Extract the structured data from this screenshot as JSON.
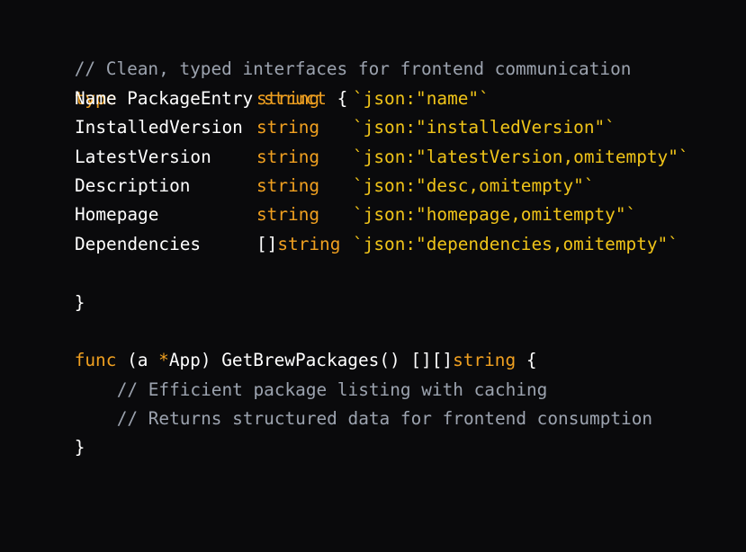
{
  "colors": {
    "background": "#0a0a0c",
    "comment": "#9ca3af",
    "keyword": "#f0a020",
    "tag": "#f0c419",
    "text": "#ffffff"
  },
  "code": {
    "header_comment": "// Clean, typed interfaces for frontend communication",
    "struct_line": {
      "kw_type": "type",
      "name": "PackageEntry",
      "kw_struct": "struct",
      "open_brace": "{"
    },
    "fields": [
      {
        "name": "Name",
        "type_prefix": "",
        "type": "string",
        "tag": "`json:\"name\"`"
      },
      {
        "name": "InstalledVersion",
        "type_prefix": "",
        "type": "string",
        "tag": "`json:\"installedVersion\"`"
      },
      {
        "name": "LatestVersion",
        "type_prefix": "",
        "type": "string",
        "tag": "`json:\"latestVersion,omitempty\"`"
      },
      {
        "name": "Description",
        "type_prefix": "",
        "type": "string",
        "tag": "`json:\"desc,omitempty\"`"
      },
      {
        "name": "Homepage",
        "type_prefix": "",
        "type": "string",
        "tag": "`json:\"homepage,omitempty\"`"
      },
      {
        "name": "Dependencies",
        "type_prefix": "[]",
        "type": "string",
        "tag": "`json:\"dependencies,omitempty\"`"
      }
    ],
    "struct_close": "}",
    "func_line": {
      "kw_func": "func",
      "receiver_open": "(a ",
      "star": "*",
      "receiver_type": "App",
      "receiver_close": ")",
      "name": "GetBrewPackages()",
      "return_prefix": "[][]",
      "return_type": "string",
      "open_brace": "{"
    },
    "body_comments": [
      "// Efficient package listing with caching",
      "// Returns structured data for frontend consumption"
    ],
    "func_close": "}"
  }
}
